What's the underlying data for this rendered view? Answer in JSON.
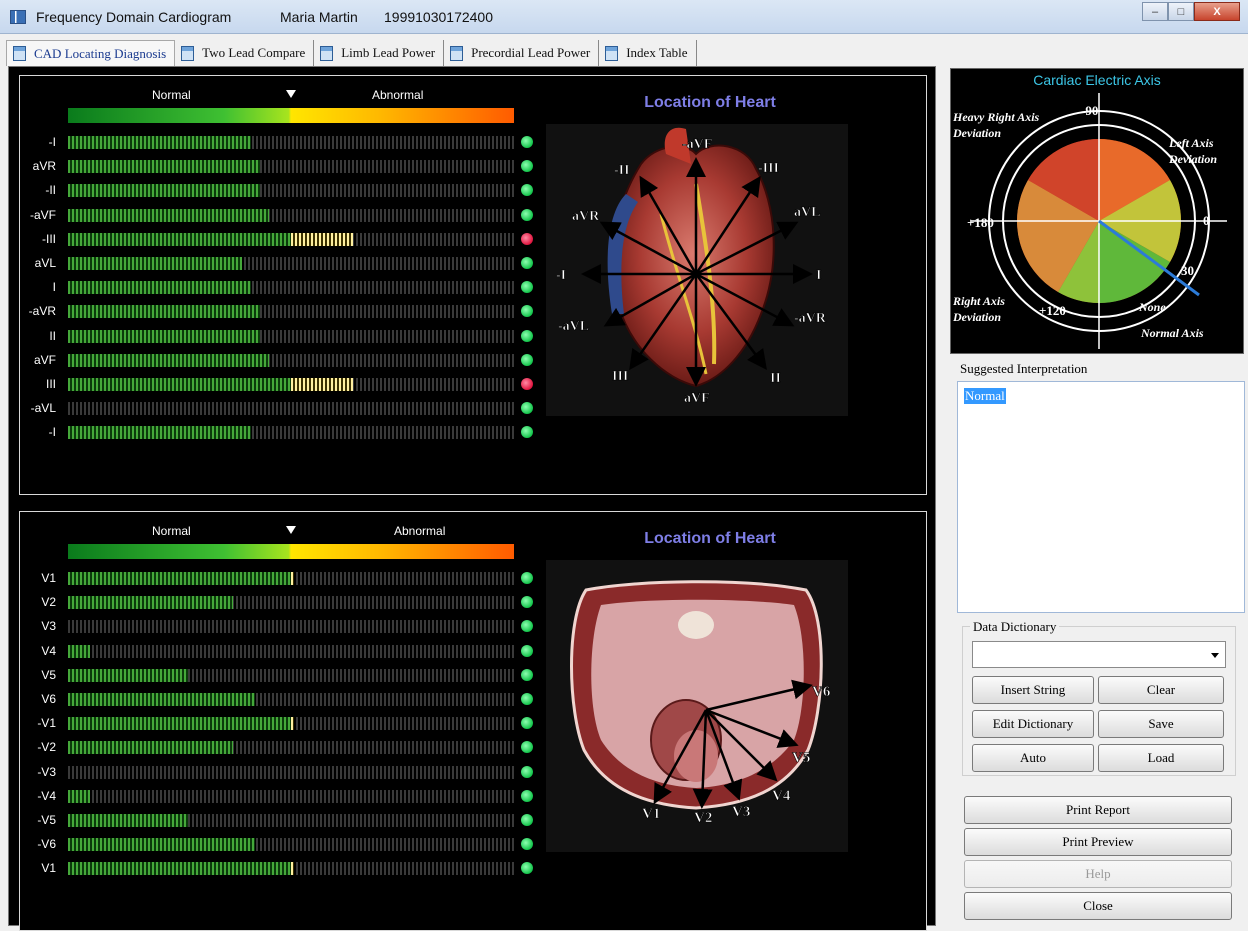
{
  "window": {
    "app_title": "Frequency Domain Cardiogram",
    "patient_name": "Maria  Martin",
    "record_id": "19991030172400",
    "controls": [
      "–",
      "□",
      "X"
    ]
  },
  "tabs": [
    {
      "label": "CAD Locating Diagnosis",
      "active": true
    },
    {
      "label": "Two Lead Compare"
    },
    {
      "label": "Limb Lead Power"
    },
    {
      "label": "Precordial Lead Power"
    },
    {
      "label": "Index Table"
    }
  ],
  "limb_section": {
    "normal_label": "Normal",
    "abnormal_label": "Abnormal",
    "location_title": "Location of Heart",
    "leads": [
      {
        "label": "-I",
        "green": 0.41,
        "yellow": 0,
        "status": "green"
      },
      {
        "label": "aVR",
        "green": 0.43,
        "yellow": 0,
        "status": "green"
      },
      {
        "label": "-II",
        "green": 0.43,
        "yellow": 0,
        "status": "green"
      },
      {
        "label": "-aVF",
        "green": 0.45,
        "yellow": 0,
        "status": "green"
      },
      {
        "label": "-III",
        "green": 0.5,
        "yellow": 0.14,
        "status": "red"
      },
      {
        "label": "aVL",
        "green": 0.39,
        "yellow": 0,
        "status": "green"
      },
      {
        "label": "I",
        "green": 0.41,
        "yellow": 0,
        "status": "green"
      },
      {
        "label": "-aVR",
        "green": 0.43,
        "yellow": 0,
        "status": "green"
      },
      {
        "label": "II",
        "green": 0.43,
        "yellow": 0,
        "status": "green"
      },
      {
        "label": "aVF",
        "green": 0.45,
        "yellow": 0,
        "status": "green"
      },
      {
        "label": "III",
        "green": 0.5,
        "yellow": 0.14,
        "status": "red"
      },
      {
        "label": "-aVL",
        "green": 0,
        "yellow": 0,
        "status": "green"
      },
      {
        "label": "-I",
        "green": 0.41,
        "yellow": 0,
        "status": "green"
      }
    ],
    "vector_labels": [
      "-aVF",
      "-II",
      "-III",
      "aVR",
      "aVL",
      "-I",
      "I",
      "-aVL",
      "-aVR",
      "III",
      "aVF",
      "II"
    ]
  },
  "precordial_section": {
    "normal_label": "Normal",
    "abnormal_label": "Abnormal",
    "location_title": "Location of Heart",
    "leads": [
      {
        "label": "V1",
        "green": 0.5,
        "yellow": 0.006,
        "status": "green"
      },
      {
        "label": "V2",
        "green": 0.37,
        "yellow": 0,
        "status": "green"
      },
      {
        "label": "V3",
        "green": 0,
        "yellow": 0,
        "status": "green"
      },
      {
        "label": "V4",
        "green": 0.05,
        "yellow": 0,
        "status": "green"
      },
      {
        "label": "V5",
        "green": 0.27,
        "yellow": 0,
        "status": "green"
      },
      {
        "label": "V6",
        "green": 0.42,
        "yellow": 0,
        "status": "green"
      },
      {
        "label": "-V1",
        "green": 0.5,
        "yellow": 0.006,
        "status": "green"
      },
      {
        "label": "-V2",
        "green": 0.37,
        "yellow": 0,
        "status": "green"
      },
      {
        "label": "-V3",
        "green": 0,
        "yellow": 0,
        "status": "green"
      },
      {
        "label": "-V4",
        "green": 0.05,
        "yellow": 0,
        "status": "green"
      },
      {
        "label": "-V5",
        "green": 0.27,
        "yellow": 0,
        "status": "green"
      },
      {
        "label": "-V6",
        "green": 0.42,
        "yellow": 0,
        "status": "green"
      },
      {
        "label": "V1",
        "green": 0.5,
        "yellow": 0.006,
        "status": "green"
      }
    ],
    "vector_labels": [
      "V6",
      "V5",
      "V4",
      "V3",
      "V2",
      "V1"
    ]
  },
  "cardiac_axis": {
    "title": "Cardiac Electric Axis",
    "deg_top": "-90",
    "deg_left": "+180",
    "deg_right": "0",
    "deg_bottom_left": "+120",
    "deg_axis": "30",
    "heavy_right": "Heavy Right Axis",
    "deviation": "Deviation",
    "left_axis": "Left Axis",
    "right_axis": "Right Axis",
    "none_label": "None",
    "normal_axis": "Normal Axis",
    "axis_angle_deg": 30
  },
  "interpretation": {
    "label": "Suggested Interpretation",
    "text": "Normal"
  },
  "dictionary": {
    "label": "Data Dictionary",
    "selected": "",
    "buttons": {
      "insert": "Insert String",
      "clear": "Clear",
      "edit": "Edit Dictionary",
      "save": "Save",
      "auto": "Auto",
      "load": "Load"
    }
  },
  "actions": {
    "print_report": "Print Report",
    "print_preview": "Print Preview",
    "help": "Help",
    "close": "Close"
  }
}
